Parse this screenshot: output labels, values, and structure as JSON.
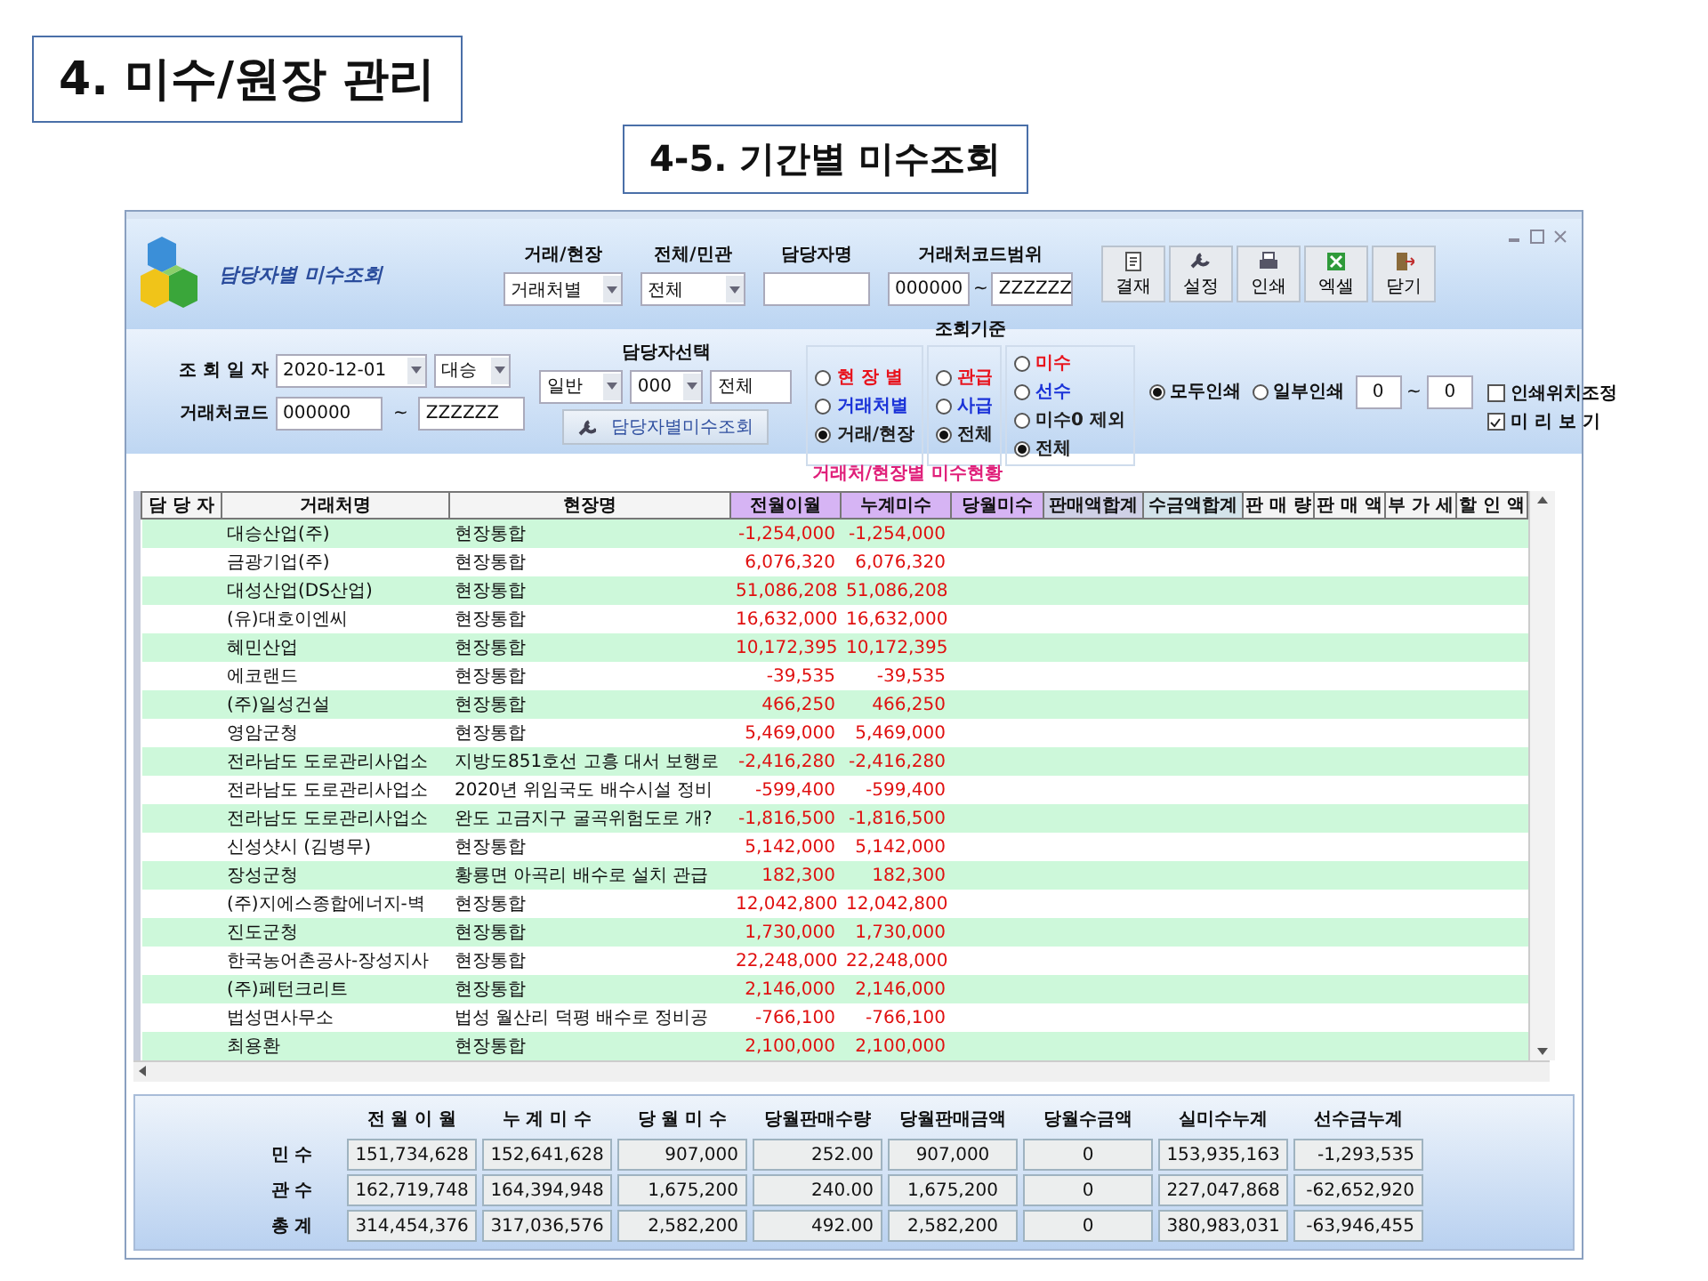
{
  "slide_title": "4. 미수/원장 관리",
  "slide_subtitle": "4-5. 기간별 미수조회",
  "window": {
    "title": "담당자별 미수조회",
    "header_fields": [
      {
        "label": "거래/현장",
        "kind": "dropdown",
        "value": "거래처별"
      },
      {
        "label": "전체/민관",
        "kind": "dropdown",
        "value": "전체"
      },
      {
        "label": "담당자명",
        "kind": "input"
      },
      {
        "label": "거래처코드범위",
        "kind": "range",
        "from": "000000",
        "separator": "~",
        "to": "ZZZZZZ"
      }
    ],
    "toolbar": [
      "결재",
      "설정",
      "인쇄",
      "엑셀",
      "닫기"
    ],
    "date": {
      "label": "조 회 일 자",
      "value": "2020-12-01",
      "branch": "대승"
    },
    "code_range": {
      "label": "거래처코드",
      "from": "000000",
      "separator": "~",
      "to": "ZZZZZZ"
    },
    "manager": {
      "label": "담당자선택",
      "type": "일반",
      "code": "000",
      "name": "전체",
      "button": "담당자별미수조회"
    },
    "criteria": {
      "label": "조회기준",
      "groups": [
        [
          {
            "label": "현 장 별",
            "color": "#e8141e",
            "selected": false
          },
          {
            "label": "거래처별",
            "color": "#1a32d8",
            "selected": false
          },
          {
            "label": "거래/현장",
            "color": "#202020",
            "selected": true
          }
        ],
        [
          {
            "label": "관급",
            "color": "#e8141e",
            "selected": false
          },
          {
            "label": "사급",
            "color": "#1a32d8",
            "selected": false
          },
          {
            "label": "전체",
            "color": "#202020",
            "selected": true
          }
        ],
        [
          {
            "label": "미수",
            "color": "#e8141e",
            "selected": false
          },
          {
            "label": "선수",
            "color": "#1a32d8",
            "selected": false
          },
          {
            "label": "미수0 제외",
            "color": "#202020",
            "selected": false
          },
          {
            "label": "전체",
            "color": "#202020",
            "selected": true
          }
        ]
      ]
    },
    "print": [
      {
        "label": "모두인쇄",
        "selected": true
      },
      {
        "label": "일부인쇄",
        "selected": false
      }
    ],
    "print_range": {
      "from": "0",
      "separator": "~",
      "to": "0"
    },
    "options": [
      {
        "label": "인쇄위치조정",
        "checked": false
      },
      {
        "label": "미 리 보 기",
        "checked": true
      }
    ],
    "grid_title": "거래처/현장별 미수현황",
    "table": {
      "columns": [
        {
          "label": "담 당 자",
          "color": "#f4f4f4"
        },
        {
          "label": "거래처명",
          "color": "#f4f4f4"
        },
        {
          "label": "현장명",
          "color": "#f4f4f4"
        },
        {
          "label": "전월이월",
          "color": "#d6b4f4"
        },
        {
          "label": "누계미수",
          "color": "#d6b4f4"
        },
        {
          "label": "당월미수",
          "color": "#d6b4f4"
        },
        {
          "label": "판매액합계",
          "color": "#cfd0e6"
        },
        {
          "label": "수금액합계",
          "color": "#d3e3ea"
        },
        {
          "label": "판 매 량",
          "color": "#f4f4f4"
        },
        {
          "label": "판 매 액",
          "color": "#f4f4f4"
        },
        {
          "label": "부 가 세",
          "color": "#f4f4f4"
        },
        {
          "label": "할 인 액",
          "color": "#f4f4f4"
        }
      ],
      "rows": [
        [
          "",
          "대승산업(주)",
          "현장통합",
          "-1,254,000",
          "-1,254,000"
        ],
        [
          "",
          "금광기업(주)",
          "현장통합",
          "6,076,320",
          "6,076,320"
        ],
        [
          "",
          "대성산업(DS산업)",
          "현장통합",
          "51,086,208",
          "51,086,208"
        ],
        [
          "",
          "(유)대호이엔씨",
          "현장통합",
          "16,632,000",
          "16,632,000"
        ],
        [
          "",
          "혜민산업",
          "현장통합",
          "10,172,395",
          "10,172,395"
        ],
        [
          "",
          "에코랜드",
          "현장통합",
          "-39,535",
          "-39,535"
        ],
        [
          "",
          "(주)일성건설",
          "현장통합",
          "466,250",
          "466,250"
        ],
        [
          "",
          "영암군청",
          "현장통합",
          "5,469,000",
          "5,469,000"
        ],
        [
          "",
          "전라남도 도로관리사업소",
          "지방도851호선 고흥 대서 보행로",
          "-2,416,280",
          "-2,416,280"
        ],
        [
          "",
          "전라남도 도로관리사업소",
          "2020년 위임국도 배수시설 정비",
          "-599,400",
          "-599,400"
        ],
        [
          "",
          "전라남도 도로관리사업소",
          "완도 고금지구 굴곡위험도로 개?",
          "-1,816,500",
          "-1,816,500"
        ],
        [
          "",
          "신성샷시 (김병무)",
          "현장통합",
          "5,142,000",
          "5,142,000"
        ],
        [
          "",
          "장성군청",
          "황룡면 아곡리 배수로 설치 관급",
          "182,300",
          "182,300"
        ],
        [
          "",
          "(주)지에스종합에너지-벽",
          "현장통합",
          "12,042,800",
          "12,042,800"
        ],
        [
          "",
          "진도군청",
          "현장통합",
          "1,730,000",
          "1,730,000"
        ],
        [
          "",
          "한국농어촌공사-장성지사",
          "현장통합",
          "22,248,000",
          "22,248,000"
        ],
        [
          "",
          "(주)페턴크리트",
          "현장통합",
          "2,146,000",
          "2,146,000"
        ],
        [
          "",
          "법성면사무소",
          "법성 월산리 덕평 배수로 정비공",
          "-766,100",
          "-766,100"
        ],
        [
          "",
          "최용환",
          "현장통합",
          "2,100,000",
          "2,100,000"
        ]
      ]
    },
    "summary": {
      "columns": [
        "전 월 이 월",
        "누 계 미 수",
        "당 월 미 수",
        "당월판매수량",
        "당월판매금액",
        "당월수금액",
        "실미수누계",
        "선수금누계"
      ],
      "rows": [
        {
          "label": "민 수",
          "values": [
            "151,734,628",
            "152,641,628",
            "907,000",
            "252.00",
            "907,000",
            "0",
            "153,935,163",
            "-1,293,535"
          ]
        },
        {
          "label": "관 수",
          "values": [
            "162,719,748",
            "164,394,948",
            "1,675,200",
            "240.00",
            "1,675,200",
            "0",
            "227,047,868",
            "-62,652,920"
          ]
        },
        {
          "label": "총 계",
          "values": [
            "314,454,376",
            "317,036,576",
            "2,582,200",
            "492.00",
            "2,582,200",
            "0",
            "380,983,031",
            "-63,946,455"
          ]
        }
      ]
    }
  }
}
